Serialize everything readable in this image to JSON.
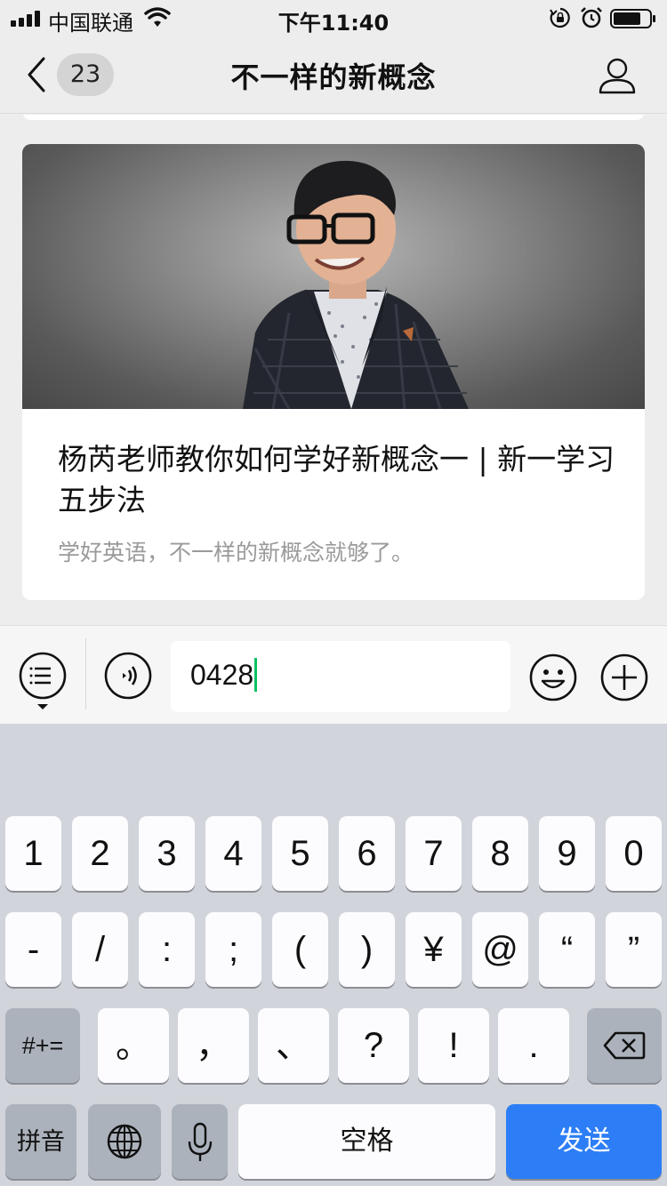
{
  "status_bar": {
    "carrier": "中国联通",
    "time": "下午11:40"
  },
  "nav": {
    "unread_count": "23",
    "title": "不一样的新概念"
  },
  "article": {
    "title": "杨芮老师教你如何学好新概念一 | 新一学习五步法",
    "description": "学好英语，不一样的新概念就够了。"
  },
  "input": {
    "value": "0428"
  },
  "keyboard": {
    "row1": [
      "1",
      "2",
      "3",
      "4",
      "5",
      "6",
      "7",
      "8",
      "9",
      "0"
    ],
    "row2": [
      "-",
      "/",
      ":",
      ";",
      "(",
      ")",
      "¥",
      "@",
      "“",
      "”"
    ],
    "row3_left": "#+=",
    "row3": [
      "。",
      "，",
      "、",
      "?",
      "!",
      "."
    ],
    "pinyin": "拼音",
    "space": "空格",
    "send": "发送"
  },
  "colors": {
    "accent_green": "#07c160",
    "send_blue": "#2d7ef6",
    "keyboard_bg": "#d1d4da"
  }
}
